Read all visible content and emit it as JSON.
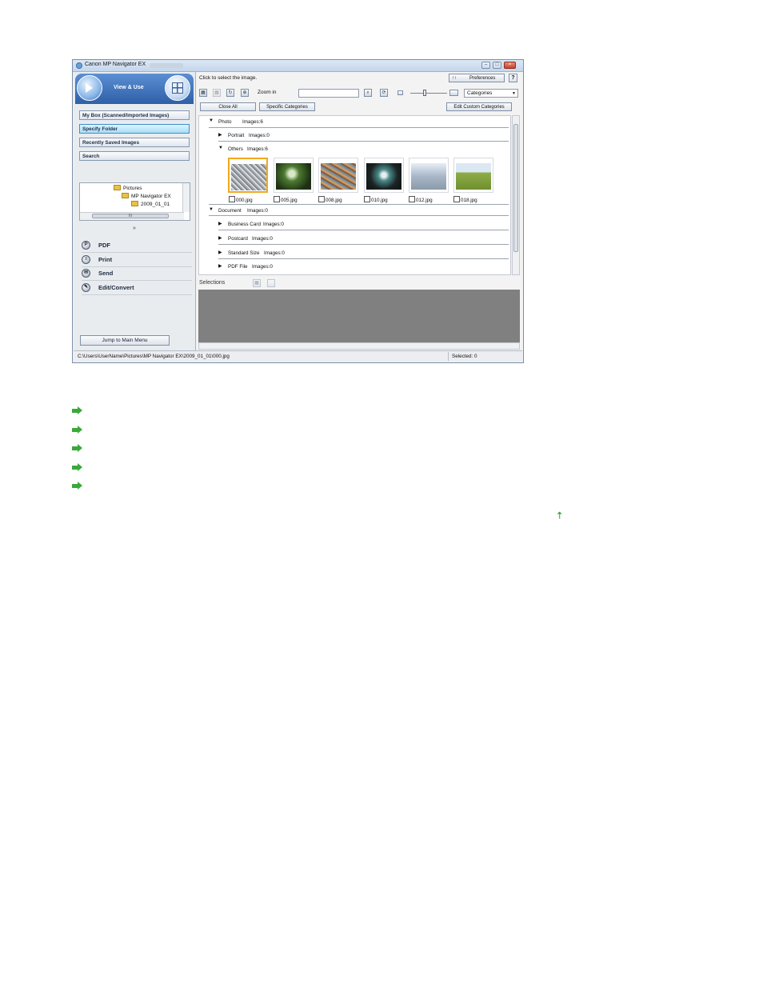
{
  "window": {
    "title": "Canon MP Navigator EX",
    "minimize": "–",
    "maximize": "□",
    "close": "×"
  },
  "sidebar": {
    "mode_label": "View & Use",
    "nav": [
      {
        "label": "My Box (Scanned/Imported Images)"
      },
      {
        "label": "Specify Folder"
      },
      {
        "label": "Recently Saved Images"
      },
      {
        "label": "Search"
      }
    ],
    "tree": [
      {
        "label": "Pictures"
      },
      {
        "label": "MP Navigator EX"
      },
      {
        "label": "2009_01_01"
      }
    ],
    "collapse_icon": "»",
    "actions": [
      {
        "label": "PDF",
        "icon": "pdf-icon"
      },
      {
        "label": "Print",
        "icon": "print-icon"
      },
      {
        "label": "Send",
        "icon": "send-icon"
      },
      {
        "label": "Edit/Convert",
        "icon": "edit-icon"
      }
    ],
    "jump_label": "Jump to Main Menu"
  },
  "main": {
    "hint": "Click to select the image.",
    "preferences_label": "Preferences",
    "help_label": "?",
    "zoom_label": "Zoom in",
    "sort_select": "Categories",
    "close_all_label": "Close All",
    "specific_categories_label": "Specific Categories",
    "edit_custom_label": "Edit Custom Categories",
    "categories": [
      {
        "name": "Photo",
        "count": "Images:6",
        "expanded": true,
        "level": 0
      },
      {
        "name": "Portrait",
        "count": "Images:0",
        "expanded": false,
        "level": 1
      },
      {
        "name": "Others",
        "count": "Images:6",
        "expanded": true,
        "level": 1
      },
      {
        "name": "Document",
        "count": "Images:0",
        "expanded": true,
        "level": 0
      },
      {
        "name": "Business Card",
        "count": "Images:0",
        "expanded": false,
        "level": 1
      },
      {
        "name": "Postcard",
        "count": "Images:0",
        "expanded": false,
        "level": 1
      },
      {
        "name": "Standard Size",
        "count": "Images:0",
        "expanded": false,
        "level": 1
      },
      {
        "name": "PDF File",
        "count": "Images:0",
        "expanded": false,
        "level": 1
      }
    ],
    "thumbnails": [
      {
        "file": "000.jpg",
        "selected": true,
        "color": "#b8bcc0"
      },
      {
        "file": "005.jpg",
        "selected": false,
        "color": "#3b5d2a"
      },
      {
        "file": "008.jpg",
        "selected": false,
        "color": "#a8754e"
      },
      {
        "file": "010.jpg",
        "selected": false,
        "color": "#2b3a3a"
      },
      {
        "file": "012.jpg",
        "selected": false,
        "color": "#aab8c8"
      },
      {
        "file": "018.jpg",
        "selected": false,
        "color": "#7d9a3a"
      }
    ],
    "selections_label": "Selections"
  },
  "status": {
    "path": "C:\\Users\\UserName\\Pictures\\MP Navigator EX\\2009_01_01\\000.jpg",
    "selected": "Selected: 0"
  },
  "page": {
    "top_link": "⇡",
    "link_count": 5
  },
  "colors": {
    "accent": "#2e5fa8",
    "selected_thumb": "#f3a71f",
    "link_arrow": "#3aa83a"
  }
}
